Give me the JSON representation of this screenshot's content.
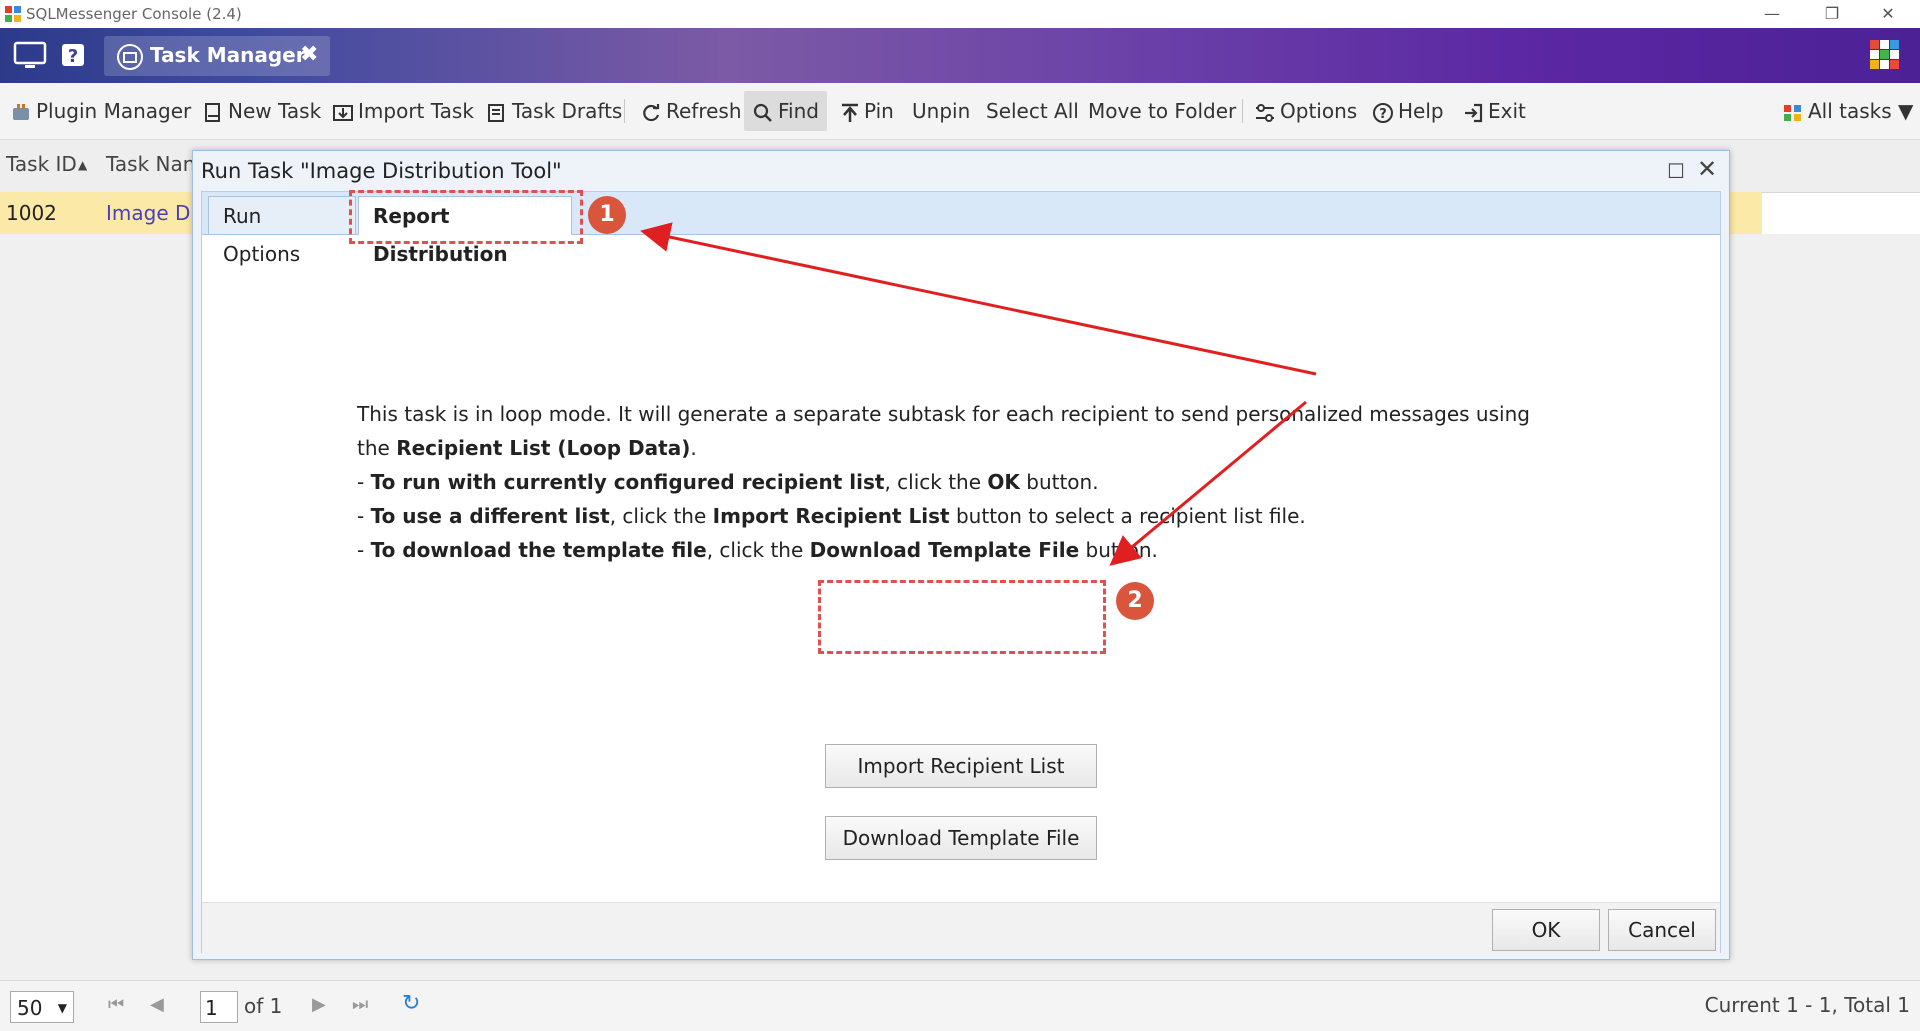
{
  "window": {
    "title": "SQLMessenger Console (2.4)",
    "controls": [
      "—",
      "❐",
      "✕"
    ]
  },
  "header": {
    "active_tab": "Task Manager",
    "tab_close": "✖"
  },
  "toolbar": {
    "plugin_manager": "Plugin Manager",
    "new_task": "New Task",
    "import_task": "Import Task",
    "task_drafts": "Task Drafts",
    "refresh": "Refresh",
    "find": "Find",
    "pin": "Pin",
    "unpin": "Unpin",
    "select_all": "Select All",
    "move_to_folder": "Move to Folder",
    "options": "Options",
    "help": "Help",
    "exit": "Exit",
    "filter": "All tasks"
  },
  "grid": {
    "columns": [
      "Task ID",
      "Task Nan"
    ],
    "row": {
      "task_id": "1002",
      "task_name": "Image Di"
    }
  },
  "footer": {
    "page_size": "50",
    "page": "1",
    "of_pages": "of 1",
    "status": "Current 1 - 1, Total 1"
  },
  "dialog": {
    "title": "Run Task \"Image Distribution Tool\"",
    "tabs": [
      "Run Options",
      "Report Distribution"
    ],
    "active_tab_index": 1,
    "message": {
      "line1_prefix": "This task is in loop mode. It will generate a separate subtask for each recipient to send personalized messages using the ",
      "line1_bold": "Recipient List (Loop Data)",
      "line1_suffix": ".",
      "line2_dash": "- ",
      "line2_bold": "To run with currently configured recipient list",
      "line2_mid": ", click the ",
      "line2_bold2": "OK",
      "line2_suffix": " button.",
      "line3_dash": "- ",
      "line3_bold": "To use a different list",
      "line3_mid": ", click the ",
      "line3_bold2": "Import Recipient List",
      "line3_suffix": " button to select a recipient list file.",
      "line4_dash": "- ",
      "line4_bold": "To download the template file",
      "line4_mid": ", click the ",
      "line4_bold2": "Download Template File",
      "line4_suffix": " button."
    },
    "import_button": "Import Recipient List",
    "download_button": "Download Template File",
    "ok_button": "OK",
    "cancel_button": "Cancel"
  },
  "annotations": {
    "badge1": "1",
    "badge2": "2",
    "color": "#e02020"
  }
}
